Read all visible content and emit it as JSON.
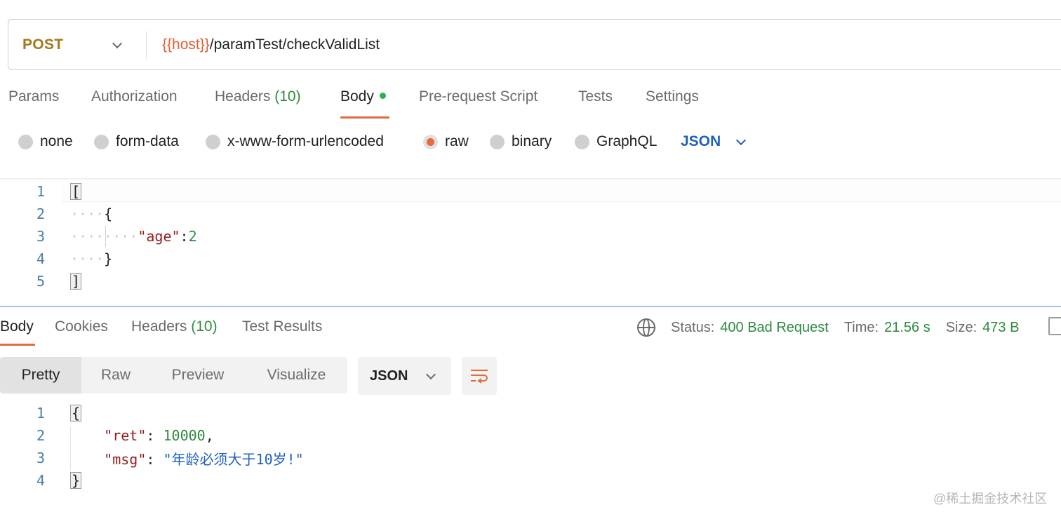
{
  "request": {
    "method": "POST",
    "url_variable": "{{host}}",
    "url_path": "/paramTest/checkValidList"
  },
  "request_tabs": [
    {
      "label": "Params"
    },
    {
      "label": "Authorization"
    },
    {
      "label": "Headers",
      "count": "(10)"
    },
    {
      "label": "Body"
    },
    {
      "label": "Pre-request Script"
    },
    {
      "label": "Tests"
    },
    {
      "label": "Settings"
    }
  ],
  "body_types": [
    "none",
    "form-data",
    "x-www-form-urlencoded",
    "raw",
    "binary",
    "GraphQL"
  ],
  "body_type_selected": "raw",
  "body_language": "JSON",
  "request_body": {
    "line_numbers": [
      "1",
      "2",
      "3",
      "4",
      "5"
    ],
    "line1": "[",
    "line2": "{",
    "key": "\"age\"",
    "colon": ":",
    "value": "2",
    "line4": "}",
    "line5": "]"
  },
  "response_tabs": [
    {
      "label": "Body"
    },
    {
      "label": "Cookies"
    },
    {
      "label": "Headers",
      "count": "(10)"
    },
    {
      "label": "Test Results"
    }
  ],
  "response_meta": {
    "status_label": "Status:",
    "status_value": "400 Bad Request",
    "time_label": "Time:",
    "time_value": "21.56 s",
    "size_label": "Size:",
    "size_value": "473 B"
  },
  "format_modes": [
    "Pretty",
    "Raw",
    "Preview",
    "Visualize"
  ],
  "response_language": "JSON",
  "response_body": {
    "line_numbers": [
      "1",
      "2",
      "3",
      "4"
    ],
    "open": "{",
    "key1": "\"ret\"",
    "sep1": ": ",
    "val1": "10000",
    "comma": ",",
    "key2": "\"msg\"",
    "sep2": ": ",
    "val2": "\"年龄必须大于10岁!\"",
    "close": "}"
  },
  "watermark": "@稀土掘金技术社区",
  "colors": {
    "accent": "#e66a3a",
    "method": "#a3781b",
    "success": "#2e8a3e",
    "link": "#1f5fbf"
  }
}
